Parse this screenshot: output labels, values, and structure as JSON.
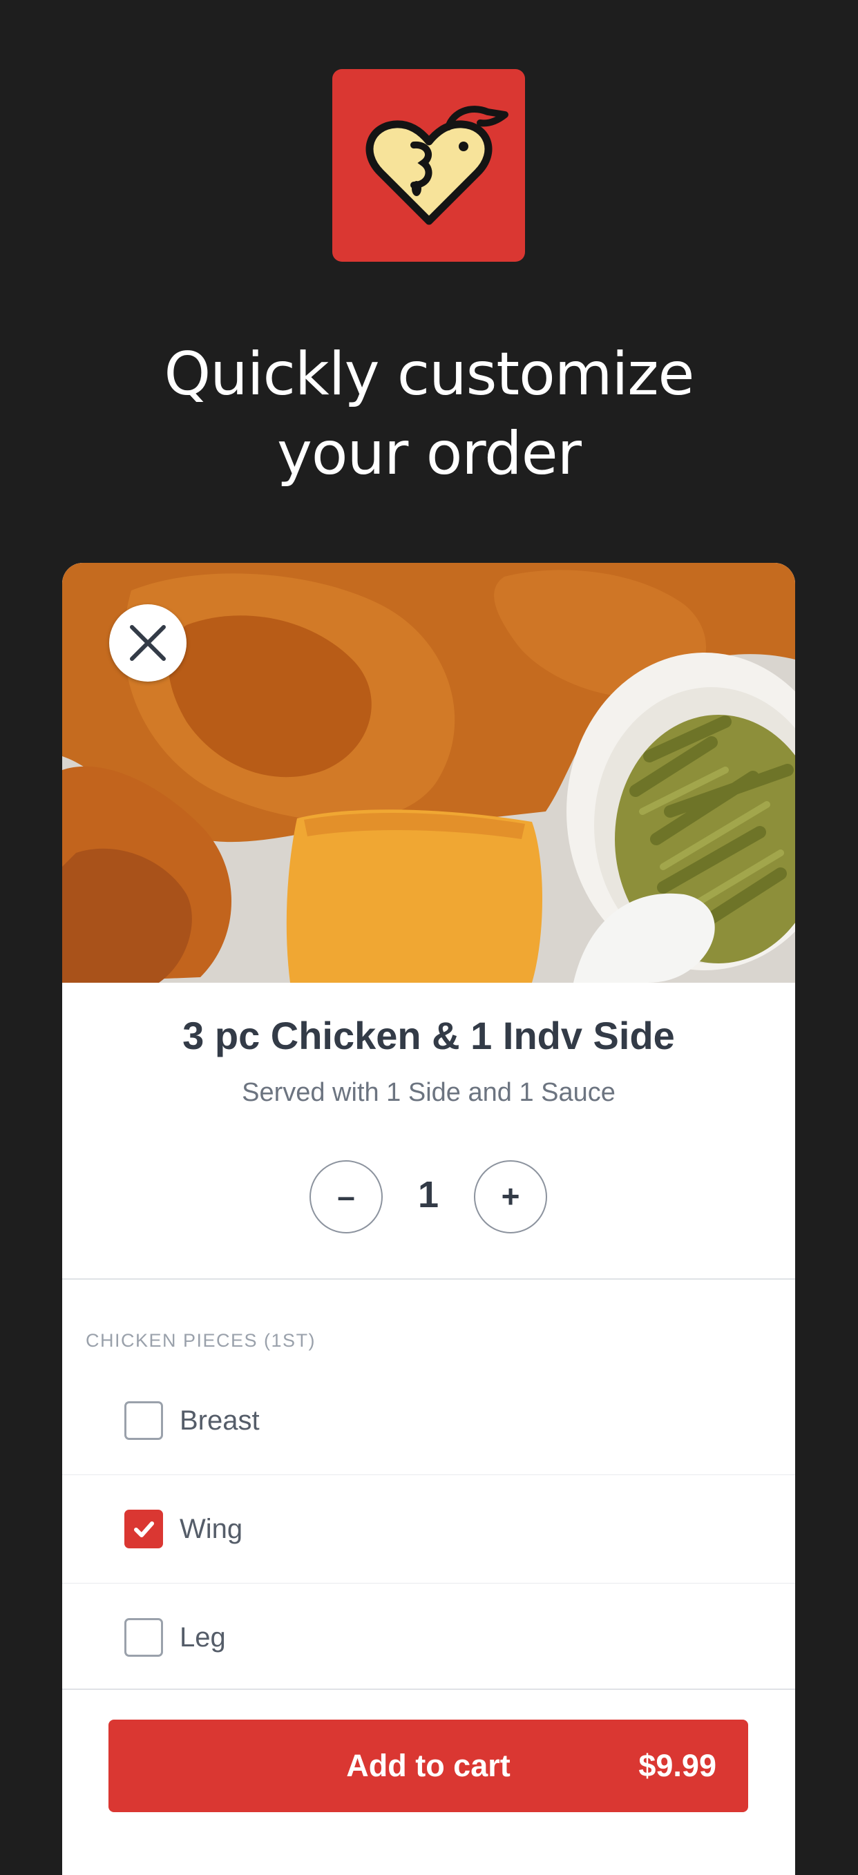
{
  "brand": {
    "logo_icon": "heart-chicken-logo-icon",
    "accent": "#da3732"
  },
  "headline": {
    "line1": "Quickly customize",
    "line2": "your order"
  },
  "item": {
    "close_icon": "close-icon",
    "title": "3 pc Chicken & 1 Indv Side",
    "description": "Served with 1 Side and 1 Sauce",
    "quantity": "1",
    "decrease_label": "–",
    "increase_label": "+"
  },
  "section": {
    "label": "CHICKEN PIECES (1ST)",
    "options": [
      {
        "label": "Breast",
        "checked": false
      },
      {
        "label": "Wing",
        "checked": true
      },
      {
        "label": "Leg",
        "checked": false
      }
    ]
  },
  "cart": {
    "button_label": "Add to cart",
    "price": "$9.99"
  }
}
